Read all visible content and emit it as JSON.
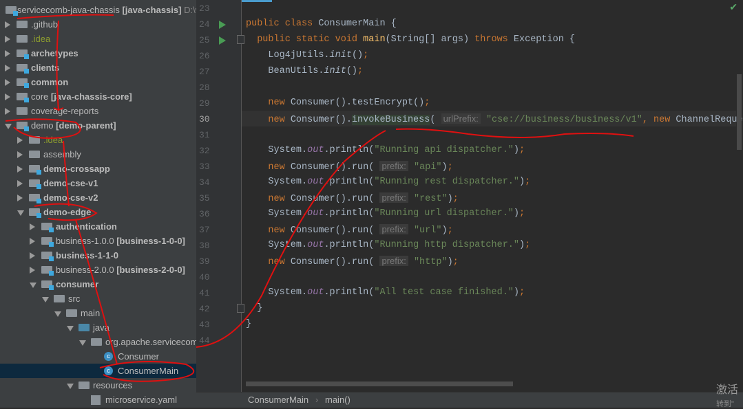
{
  "project_tree": {
    "root": {
      "name": "servicecomb-java-chassis",
      "module": "[java-chassis]",
      "path": "D:\\w"
    },
    "items": [
      {
        "label": ".github",
        "level": 1,
        "expanded": false,
        "style": "normal",
        "icon": "folder"
      },
      {
        "label": ".idea",
        "level": 1,
        "expanded": false,
        "style": "olive",
        "icon": "folder"
      },
      {
        "label": "archetypes",
        "level": 1,
        "expanded": false,
        "style": "bold",
        "icon": "module"
      },
      {
        "label": "clients",
        "level": 1,
        "expanded": false,
        "style": "bold",
        "icon": "module"
      },
      {
        "label": "common",
        "level": 1,
        "expanded": false,
        "style": "bold",
        "icon": "module"
      },
      {
        "label": "core",
        "module": "[java-chassis-core]",
        "level": 1,
        "expanded": false,
        "style": "normal",
        "icon": "module"
      },
      {
        "label": "coverage-reports",
        "level": 1,
        "expanded": false,
        "style": "normal",
        "icon": "folder"
      },
      {
        "label": "demo",
        "module": "[demo-parent]",
        "level": 1,
        "expanded": true,
        "style": "normal",
        "icon": "module"
      },
      {
        "label": ".idea",
        "level": 2,
        "expanded": false,
        "style": "olive",
        "icon": "folder"
      },
      {
        "label": "assembly",
        "level": 2,
        "expanded": false,
        "style": "normal",
        "icon": "folder"
      },
      {
        "label": "demo-crossapp",
        "level": 2,
        "expanded": false,
        "style": "bold",
        "icon": "module"
      },
      {
        "label": "demo-cse-v1",
        "level": 2,
        "expanded": false,
        "style": "bold",
        "icon": "module"
      },
      {
        "label": "demo-cse-v2",
        "level": 2,
        "expanded": false,
        "style": "bold",
        "icon": "module"
      },
      {
        "label": "demo-edge",
        "level": 2,
        "expanded": true,
        "style": "bold",
        "icon": "module"
      },
      {
        "label": "authentication",
        "level": 3,
        "expanded": false,
        "style": "bold",
        "icon": "module"
      },
      {
        "label": "business-1.0.0",
        "module": "[business-1-0-0]",
        "level": 3,
        "expanded": false,
        "style": "normal",
        "icon": "module"
      },
      {
        "label": "business-1-1-0",
        "level": 3,
        "expanded": false,
        "style": "bold",
        "icon": "module"
      },
      {
        "label": "business-2.0.0",
        "module": "[business-2-0-0]",
        "level": 3,
        "expanded": false,
        "style": "normal",
        "icon": "module"
      },
      {
        "label": "consumer",
        "level": 3,
        "expanded": true,
        "style": "bold",
        "icon": "module"
      },
      {
        "label": "src",
        "level": 4,
        "expanded": true,
        "style": "normal",
        "icon": "folder"
      },
      {
        "label": "main",
        "level": 5,
        "expanded": true,
        "style": "normal",
        "icon": "folder"
      },
      {
        "label": "java",
        "level": 6,
        "expanded": true,
        "style": "normal",
        "icon": "source"
      },
      {
        "label": "org.apache.servicecom",
        "level": 7,
        "expanded": true,
        "style": "normal",
        "icon": "package"
      },
      {
        "label": "Consumer",
        "level": 8,
        "style": "normal",
        "icon": "class"
      },
      {
        "label": "ConsumerMain",
        "level": 8,
        "style": "normal",
        "icon": "class",
        "selected": true
      },
      {
        "label": "resources",
        "level": 6,
        "expanded": true,
        "style": "normal",
        "icon": "folder"
      },
      {
        "label": "microservice.yaml",
        "level": 7,
        "style": "normal",
        "icon": "yaml"
      }
    ]
  },
  "editor": {
    "current_line": 30,
    "lines": [
      {
        "n": "23",
        "run": false,
        "tokens": []
      },
      {
        "n": "24",
        "run": true,
        "tokens": [
          [
            "public class ",
            "kw"
          ],
          [
            "ConsumerMain {",
            ""
          ]
        ]
      },
      {
        "n": "25",
        "run": true,
        "fold": true,
        "tokens": [
          [
            "  public static void ",
            "kw"
          ],
          [
            "main",
            "fn"
          ],
          [
            "(String[] args) ",
            ""
          ],
          [
            "throws ",
            "kw"
          ],
          [
            "Exception {",
            ""
          ]
        ]
      },
      {
        "n": "26",
        "tokens": [
          [
            "    Log4jUtils.",
            ""
          ],
          [
            "init",
            "it"
          ],
          [
            "()",
            ""
          ],
          [
            ";",
            "kw"
          ]
        ]
      },
      {
        "n": "27",
        "tokens": [
          [
            "    BeanUtils.",
            ""
          ],
          [
            "init",
            "it"
          ],
          [
            "()",
            ""
          ],
          [
            ";",
            "kw"
          ]
        ]
      },
      {
        "n": "28",
        "tokens": []
      },
      {
        "n": "29",
        "tokens": [
          [
            "    new ",
            "kw"
          ],
          [
            "Consumer().testEncrypt()",
            ""
          ],
          [
            ";",
            "kw"
          ]
        ]
      },
      {
        "n": "30",
        "tokens": [
          [
            "    new ",
            "kw"
          ],
          [
            "Consumer().",
            ""
          ],
          [
            "invokeBusiness",
            "hl"
          ],
          [
            "( ",
            ""
          ],
          [
            "urlPrefix:",
            "hint"
          ],
          [
            " \"cse://business/business/v1\"",
            "st"
          ],
          [
            ", ",
            "kw"
          ],
          [
            "new ",
            "kw"
          ],
          [
            "ChannelReque",
            ""
          ]
        ]
      },
      {
        "n": "31",
        "tokens": []
      },
      {
        "n": "32",
        "tokens": [
          [
            "    System.",
            ""
          ],
          [
            "out",
            "itp"
          ],
          [
            ".println(",
            ""
          ],
          [
            "\"Running api dispatcher.\"",
            "st"
          ],
          [
            ")",
            ""
          ],
          [
            ";",
            "kw"
          ]
        ]
      },
      {
        "n": "33",
        "tokens": [
          [
            "    new ",
            "kw"
          ],
          [
            "Consumer().run( ",
            ""
          ],
          [
            "prefix:",
            "hint"
          ],
          [
            " \"api\"",
            "st"
          ],
          [
            ")",
            ""
          ],
          [
            ";",
            "kw"
          ]
        ]
      },
      {
        "n": "34",
        "tokens": [
          [
            "    System.",
            ""
          ],
          [
            "out",
            "itp"
          ],
          [
            ".println(",
            ""
          ],
          [
            "\"Running rest dispatcher.\"",
            "st"
          ],
          [
            ")",
            ""
          ],
          [
            ";",
            "kw"
          ]
        ]
      },
      {
        "n": "35",
        "tokens": [
          [
            "    new ",
            "kw"
          ],
          [
            "Consumer().run( ",
            ""
          ],
          [
            "prefix:",
            "hint"
          ],
          [
            " \"rest\"",
            "st"
          ],
          [
            ")",
            ""
          ],
          [
            ";",
            "kw"
          ]
        ]
      },
      {
        "n": "36",
        "tokens": [
          [
            "    System.",
            ""
          ],
          [
            "out",
            "itp"
          ],
          [
            ".println(",
            ""
          ],
          [
            "\"Running url dispatcher.\"",
            "st"
          ],
          [
            ")",
            ""
          ],
          [
            ";",
            "kw"
          ]
        ]
      },
      {
        "n": "37",
        "tokens": [
          [
            "    new ",
            "kw"
          ],
          [
            "Consumer().run( ",
            ""
          ],
          [
            "prefix:",
            "hint"
          ],
          [
            " \"url\"",
            "st"
          ],
          [
            ")",
            ""
          ],
          [
            ";",
            "kw"
          ]
        ]
      },
      {
        "n": "38",
        "tokens": [
          [
            "    System.",
            ""
          ],
          [
            "out",
            "itp"
          ],
          [
            ".println(",
            ""
          ],
          [
            "\"Running http dispatcher.\"",
            "st"
          ],
          [
            ")",
            ""
          ],
          [
            ";",
            "kw"
          ]
        ]
      },
      {
        "n": "39",
        "tokens": [
          [
            "    new ",
            "kw"
          ],
          [
            "Consumer().run( ",
            ""
          ],
          [
            "prefix:",
            "hint"
          ],
          [
            " \"http\"",
            "st"
          ],
          [
            ")",
            ""
          ],
          [
            ";",
            "kw"
          ]
        ]
      },
      {
        "n": "40",
        "tokens": []
      },
      {
        "n": "41",
        "tokens": [
          [
            "    System.",
            ""
          ],
          [
            "out",
            "itp"
          ],
          [
            ".println(",
            ""
          ],
          [
            "\"All test case finished.\"",
            "st"
          ],
          [
            ")",
            ""
          ],
          [
            ";",
            "kw"
          ]
        ]
      },
      {
        "n": "42",
        "fold": true,
        "tokens": [
          [
            "  }",
            ""
          ]
        ]
      },
      {
        "n": "43",
        "tokens": [
          [
            "}",
            ""
          ]
        ]
      },
      {
        "n": "44",
        "tokens": []
      }
    ]
  },
  "breadcrumbs": [
    "ConsumerMain",
    "main()"
  ],
  "status_icon": "check-icon",
  "status_icon_glyph": "✔",
  "watermark": {
    "line1": "激活",
    "line2": "转到\""
  }
}
